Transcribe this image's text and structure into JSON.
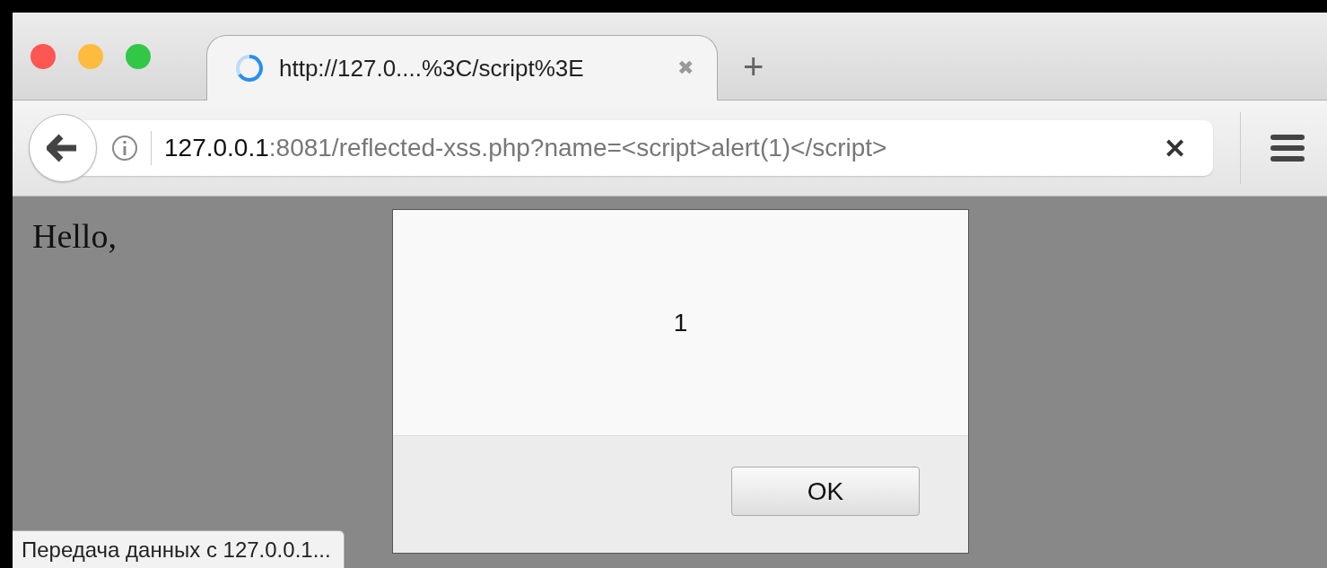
{
  "window": {
    "controls": [
      {
        "color": "#fc5753"
      },
      {
        "color": "#fdbc40"
      },
      {
        "color": "#33c748"
      }
    ]
  },
  "tabs": [
    {
      "title": "http://127.0....%3C/script%3E",
      "selected": true,
      "loading": true,
      "close": "✖"
    }
  ],
  "new_tab": "+",
  "address_bar": {
    "host": "127.0.0.1",
    "rest": ":8081/reflected-xss.php?name=<script>alert(1)</script>",
    "stop": "✕"
  },
  "page": {
    "text": "Hello,"
  },
  "dialog": {
    "message": "1",
    "buttons": [
      "OK"
    ]
  },
  "status_bar": {
    "text": "Передача данных с 127.0.0.1..."
  }
}
